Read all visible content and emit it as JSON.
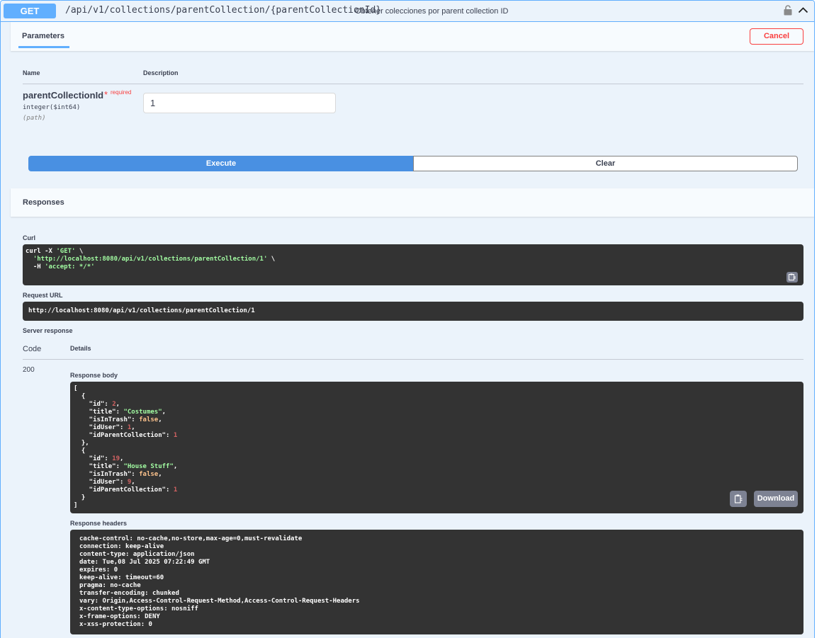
{
  "summary": {
    "method": "GET",
    "path": "/api/v1/collections/parentCollection/{parentCollectionId}",
    "description": "Obtener colecciones por parent collection ID"
  },
  "parameters": {
    "tab_label": "Parameters",
    "cancel_label": "Cancel",
    "col_name": "Name",
    "col_description": "Description",
    "param": {
      "name": "parentCollectionId",
      "required_star": "*",
      "required_label": "required",
      "type": "integer($int64)",
      "location": "(path)",
      "value": "1"
    },
    "execute_label": "Execute",
    "clear_label": "Clear"
  },
  "responses": {
    "title": "Responses",
    "curl_label": "Curl",
    "curl_lines": [
      {
        "prefix": "curl -X ",
        "str": "'GET'",
        "suffix": " \\"
      },
      {
        "prefix": "  ",
        "str": "'http://localhost:8080/api/v1/collections/parentCollection/1'",
        "suffix": " \\"
      },
      {
        "prefix": "  -H ",
        "str": "'accept: */*'",
        "suffix": ""
      }
    ],
    "request_url_label": "Request URL",
    "request_url": "http://localhost:8080/api/v1/collections/parentCollection/1",
    "server_response_label": "Server response",
    "code_header": "Code",
    "details_header": "Details",
    "status_code": "200",
    "body_label": "Response body",
    "body_items": [
      {
        "id": "2",
        "title": "\"Costumes\"",
        "isInTrash": "false",
        "idUser": "1",
        "idParentCollection": "1"
      },
      {
        "id": "19",
        "title": "\"House Stuff\"",
        "isInTrash": "false",
        "idUser": "9",
        "idParentCollection": "1"
      }
    ],
    "download_label": "Download",
    "headers_label": "Response headers",
    "headers": [
      "cache-control: no-cache,no-store,max-age=0,must-revalidate",
      "connection: keep-alive",
      "content-type: application/json",
      "date: Tue,08 Jul 2025 07:22:49 GMT",
      "expires: 0",
      "keep-alive: timeout=60",
      "pragma: no-cache",
      "transfer-encoding: chunked",
      "vary: Origin,Access-Control-Request-Method,Access-Control-Request-Headers",
      "x-content-type-options: nosniff",
      "x-frame-options: DENY",
      "x-xss-protection: 0"
    ]
  },
  "colors": {
    "method_get": "#61affe",
    "execute": "#4990e2",
    "cancel": "#f93e3e",
    "code_bg": "#333333"
  },
  "icons": [
    "lock-icon",
    "chevron-up-icon",
    "copy-icon"
  ]
}
